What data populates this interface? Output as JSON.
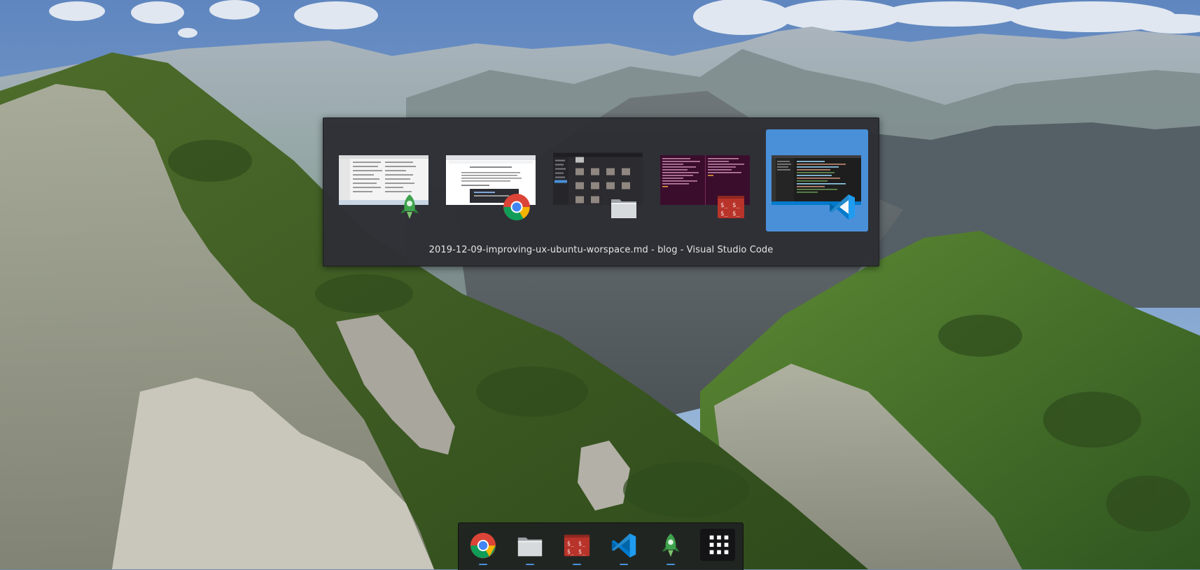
{
  "switcher": {
    "selected_title": "2019-12-09-improving-ux-ubuntu-worspace.md - blog - Visual Studio Code",
    "windows": [
      {
        "app": "git-client",
        "icon": "rocket-icon",
        "selected": false
      },
      {
        "app": "chrome",
        "icon": "chrome-icon",
        "selected": false
      },
      {
        "app": "files",
        "icon": "folder-icon",
        "selected": false
      },
      {
        "app": "terminal",
        "icon": "terminal-icon",
        "selected": false
      },
      {
        "app": "vscode",
        "icon": "vscode-icon",
        "selected": true
      }
    ]
  },
  "dock": {
    "items": [
      {
        "app": "chrome",
        "icon": "chrome-icon",
        "running": true
      },
      {
        "app": "files",
        "icon": "folder-icon",
        "running": true
      },
      {
        "app": "terminal",
        "icon": "terminal-icon",
        "running": true
      },
      {
        "app": "vscode",
        "icon": "vscode-icon",
        "running": true
      },
      {
        "app": "git-client",
        "icon": "rocket-icon",
        "running": true
      },
      {
        "app": "show-applications",
        "icon": "grid-icon",
        "running": false
      }
    ]
  },
  "colors": {
    "accent": "#4a90d9",
    "switcher_bg": "#2d2e34",
    "dock_bg": "#1e1e22"
  }
}
